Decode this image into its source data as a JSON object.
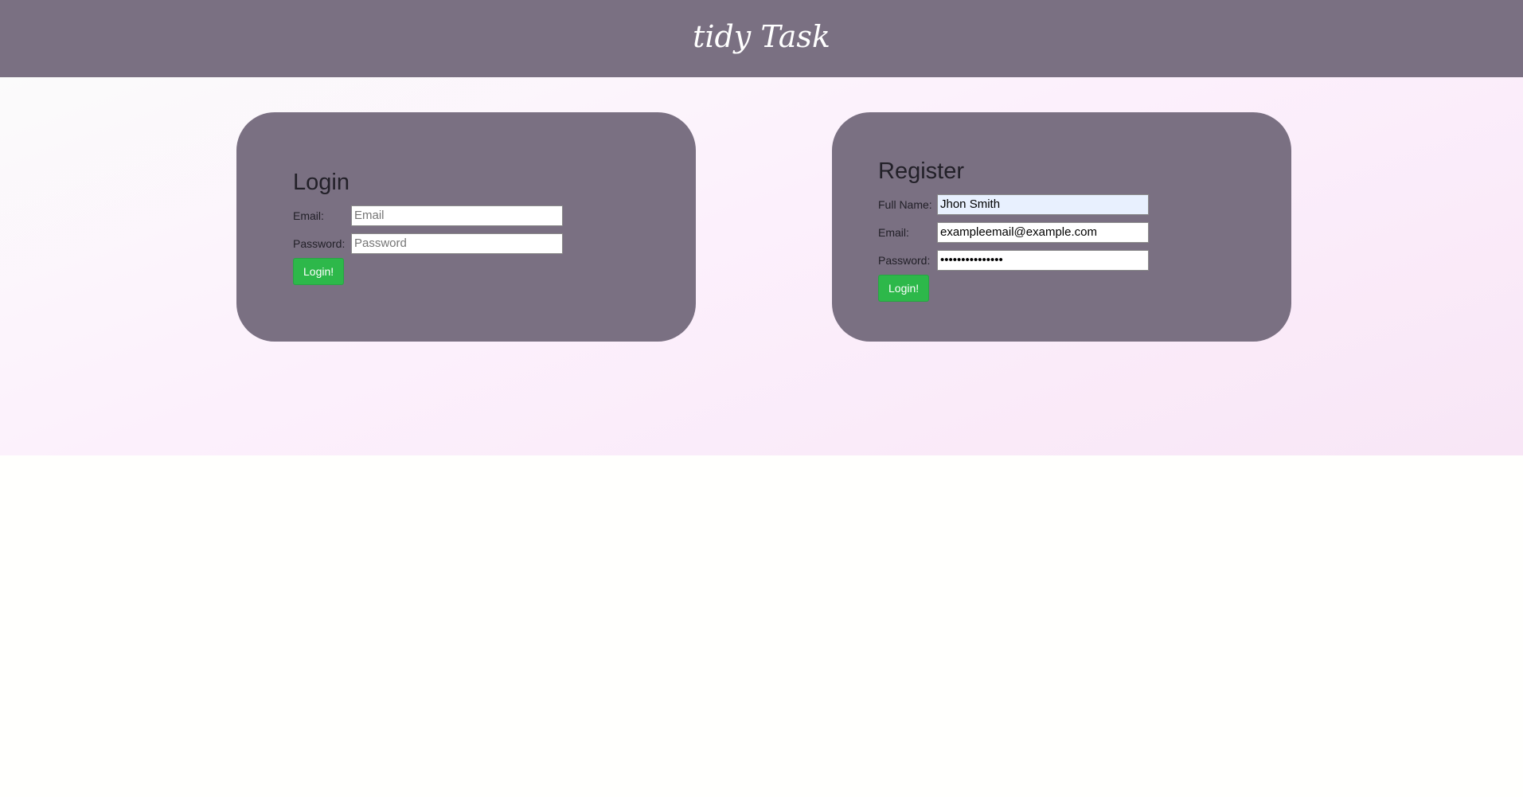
{
  "header": {
    "brand": "tidy Task"
  },
  "login": {
    "title": "Login",
    "email_label": "Email:",
    "email_placeholder": "Email",
    "email_value": "",
    "password_label": "Password:",
    "password_placeholder": "Password",
    "password_value": "",
    "submit_label": "Login!"
  },
  "register": {
    "title": "Register",
    "fullname_label": "Full Name:",
    "fullname_value": "Jhon Smith",
    "email_label": "Email:",
    "email_value": "exampleemail@example.com",
    "password_label": "Password:",
    "password_value": "•••••••••••••••",
    "submit_label": "Login!"
  },
  "colors": {
    "header_bg": "#7a7082",
    "card_bg": "#7a7082",
    "button_bg": "#2db84a"
  }
}
